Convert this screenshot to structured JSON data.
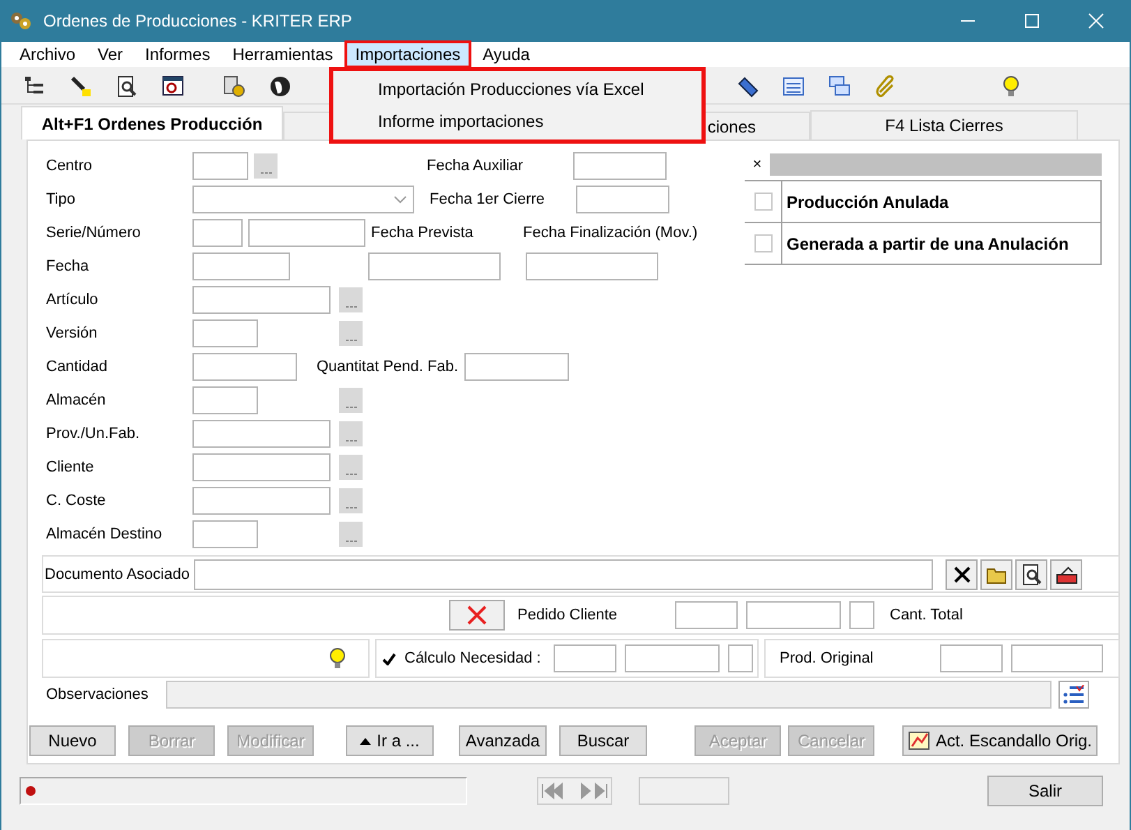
{
  "window": {
    "title": "Ordenes de Producciones - KRITER ERP"
  },
  "menu": [
    {
      "label": "Archivo",
      "selected": false
    },
    {
      "label": "Ver",
      "selected": false
    },
    {
      "label": "Informes",
      "selected": false
    },
    {
      "label": "Herramientas",
      "selected": false
    },
    {
      "label": "Importaciones",
      "selected": true
    },
    {
      "label": "Ayuda",
      "selected": false
    }
  ],
  "dropdown": [
    "Importación Producciones vía Excel",
    "Informe importaciones"
  ],
  "tabs": [
    {
      "label": "Alt+F1 Ordenes Producción",
      "selected": true
    },
    {
      "label": "ciones",
      "selected": false
    },
    {
      "label": "F4 Lista Cierres",
      "selected": false
    }
  ],
  "fields": [
    "Centro",
    "Tipo",
    "Serie/Número",
    "Fecha",
    "Artículo",
    "Versión",
    "Cantidad",
    "Almacén",
    "Prov./Un.Fab.",
    "Cliente",
    "C. Coste",
    "Almacén Destino"
  ],
  "extra_labels": [
    "Fecha Auxiliar",
    "Fecha 1er Cierre",
    "Fecha Prevista",
    "Fecha Finalización (Mov.)",
    "Quantitat Pend. Fab."
  ],
  "flags_panel": {
    "close": "×",
    "flags": [
      {
        "label": "Producción Anulada",
        "checked": false
      },
      {
        "label": "Generada a partir de una Anulación",
        "checked": false
      }
    ]
  },
  "document_label": "Documento Asociado",
  "pedido_label": "Pedido Cliente",
  "cant_total_label": "Cant. Total",
  "calculo": {
    "label": "Cálculo Necesidad :",
    "checked": true
  },
  "prod_original_label": "Prod. Original",
  "observaciones_label": "Observaciones",
  "buttons": [
    {
      "label": "Nuevo",
      "disabled": false
    },
    {
      "label": "Borrar",
      "disabled": true
    },
    {
      "label": "Modificar",
      "disabled": true
    },
    {
      "label": "Ir a ...",
      "disabled": false
    },
    {
      "label": "Avanzada",
      "disabled": false
    },
    {
      "label": "Buscar",
      "disabled": false
    },
    {
      "label": "Aceptar",
      "disabled": true
    },
    {
      "label": "Cancelar",
      "disabled": true
    },
    {
      "label": "Act. Escandallo Orig.",
      "disabled": false
    }
  ],
  "exit_button": "Salir"
}
